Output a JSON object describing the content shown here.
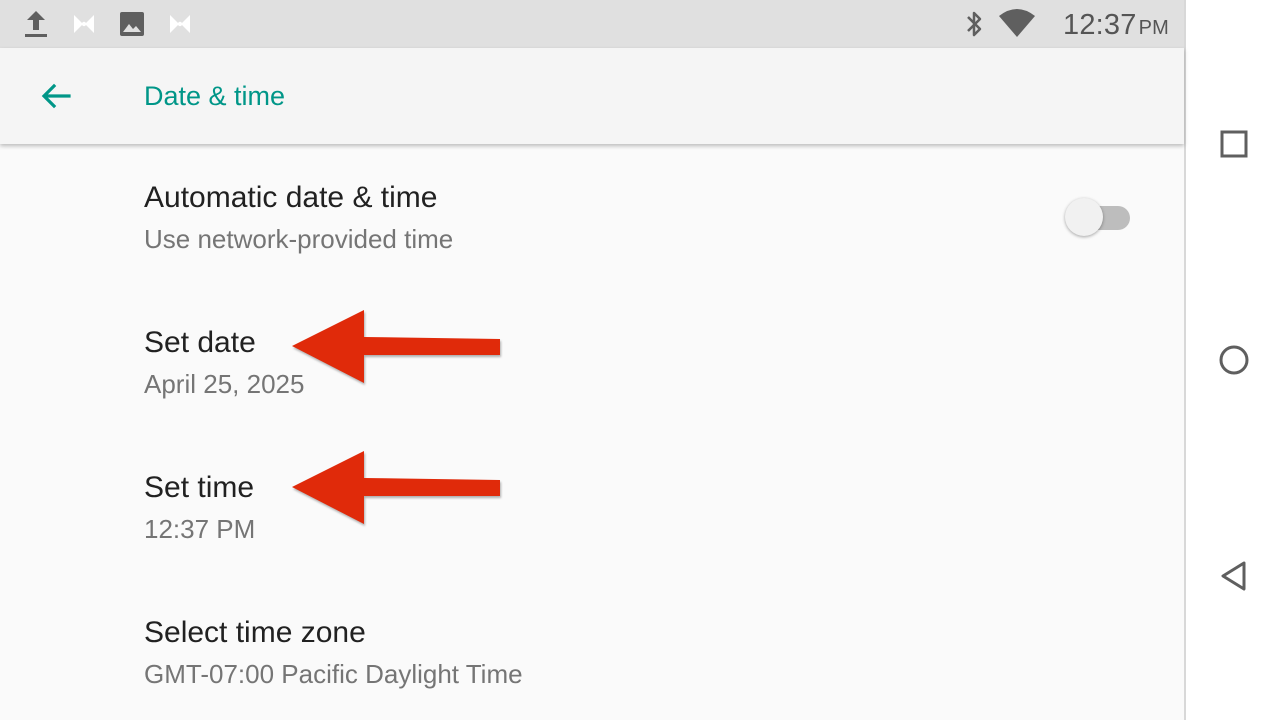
{
  "status_bar": {
    "time": "12:37",
    "ampm": "PM",
    "left_icons": [
      "upload-icon",
      "app-notification-icon",
      "image-icon",
      "app-notification-icon"
    ],
    "right_icons": [
      "bluetooth-icon",
      "wifi-icon"
    ]
  },
  "app_bar": {
    "title": "Date & time",
    "back_icon": "arrow-back-icon"
  },
  "settings": [
    {
      "title": "Automatic date & time",
      "summary": "Use network-provided time",
      "switch_on": false
    },
    {
      "title": "Set date",
      "summary": "April 25, 2025"
    },
    {
      "title": "Set time",
      "summary": "12:37 PM"
    },
    {
      "title": "Select time zone",
      "summary": "GMT-07:00 Pacific Daylight Time"
    }
  ],
  "nav_bar": {
    "buttons": [
      "overview-square-icon",
      "home-circle-icon",
      "back-triangle-icon"
    ]
  },
  "colors": {
    "accent": "#009688",
    "annotation_red": "#e02a0a",
    "status_bar_bg": "#e0e0e0",
    "app_bar_bg": "#f5f5f5",
    "list_bg": "#fafafa"
  }
}
